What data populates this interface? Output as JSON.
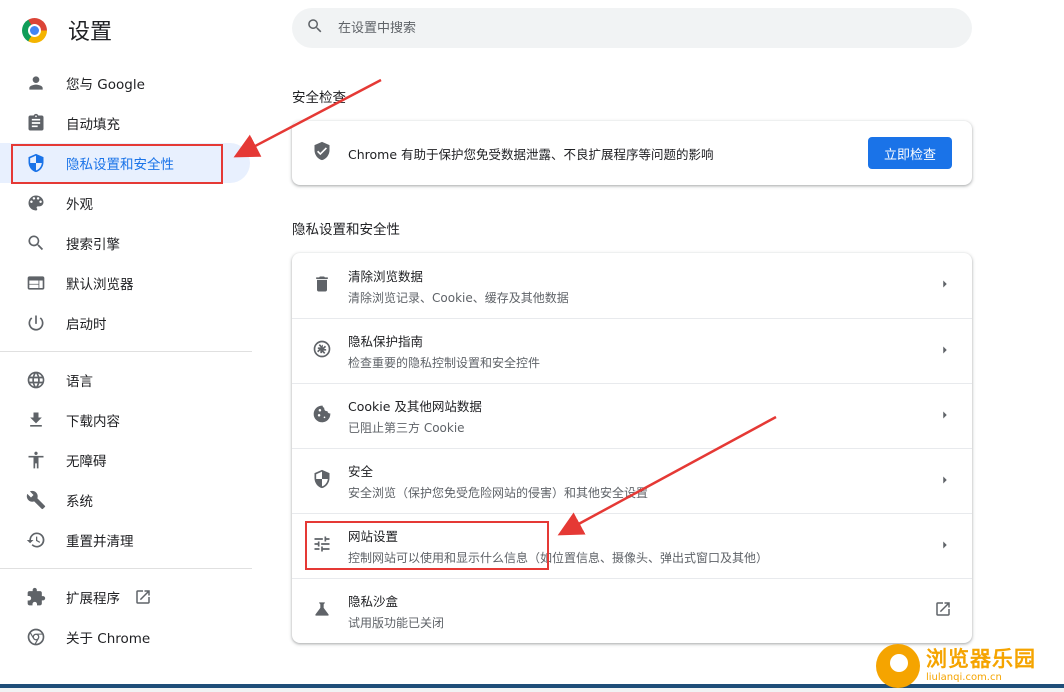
{
  "app": {
    "title": "设置"
  },
  "search": {
    "placeholder": "在设置中搜索"
  },
  "sidebar": {
    "items": [
      {
        "label": "您与 Google",
        "icon": "person-icon"
      },
      {
        "label": "自动填充",
        "icon": "clipboard-icon"
      },
      {
        "label": "隐私设置和安全性",
        "icon": "shield-icon",
        "active": true
      },
      {
        "label": "外观",
        "icon": "palette-icon"
      },
      {
        "label": "搜索引擎",
        "icon": "search-icon"
      },
      {
        "label": "默认浏览器",
        "icon": "browser-icon"
      },
      {
        "label": "启动时",
        "icon": "power-icon"
      },
      {
        "label": "语言",
        "icon": "globe-icon"
      },
      {
        "label": "下载内容",
        "icon": "download-icon"
      },
      {
        "label": "无障碍",
        "icon": "accessibility-icon"
      },
      {
        "label": "系统",
        "icon": "wrench-icon"
      },
      {
        "label": "重置并清理",
        "icon": "restore-icon"
      },
      {
        "label": "扩展程序",
        "icon": "puzzle-icon"
      },
      {
        "label": "关于 Chrome",
        "icon": "chrome-icon"
      }
    ]
  },
  "safety_check": {
    "title": "安全检查",
    "text": "Chrome 有助于保护您免受数据泄露、不良扩展程序等问题的影响",
    "button_label": "立即检查"
  },
  "privacy": {
    "title": "隐私设置和安全性",
    "rows": [
      {
        "title": "清除浏览数据",
        "subtitle": "清除浏览记录、Cookie、缓存及其他数据",
        "icon": "trash-icon"
      },
      {
        "title": "隐私保护指南",
        "subtitle": "检查重要的隐私控制设置和安全控件",
        "icon": "compass-icon"
      },
      {
        "title": "Cookie 及其他网站数据",
        "subtitle": "已阻止第三方 Cookie",
        "icon": "cookie-icon"
      },
      {
        "title": "安全",
        "subtitle": "安全浏览（保护您免受危险网站的侵害）和其他安全设置",
        "icon": "shield-icon"
      },
      {
        "title": "网站设置",
        "subtitle": "控制网站可以使用和显示什么信息（如位置信息、摄像头、弹出式窗口及其他）",
        "icon": "tune-icon"
      },
      {
        "title": "隐私沙盒",
        "subtitle": "试用版功能已关闭",
        "icon": "flask-icon"
      }
    ]
  },
  "watermark": {
    "name": "浏览器乐园",
    "url": "liulanqi.com.cn"
  },
  "colors": {
    "accent": "#1a73e8",
    "annotation": "#e53935",
    "watermark": "#f5a400"
  }
}
